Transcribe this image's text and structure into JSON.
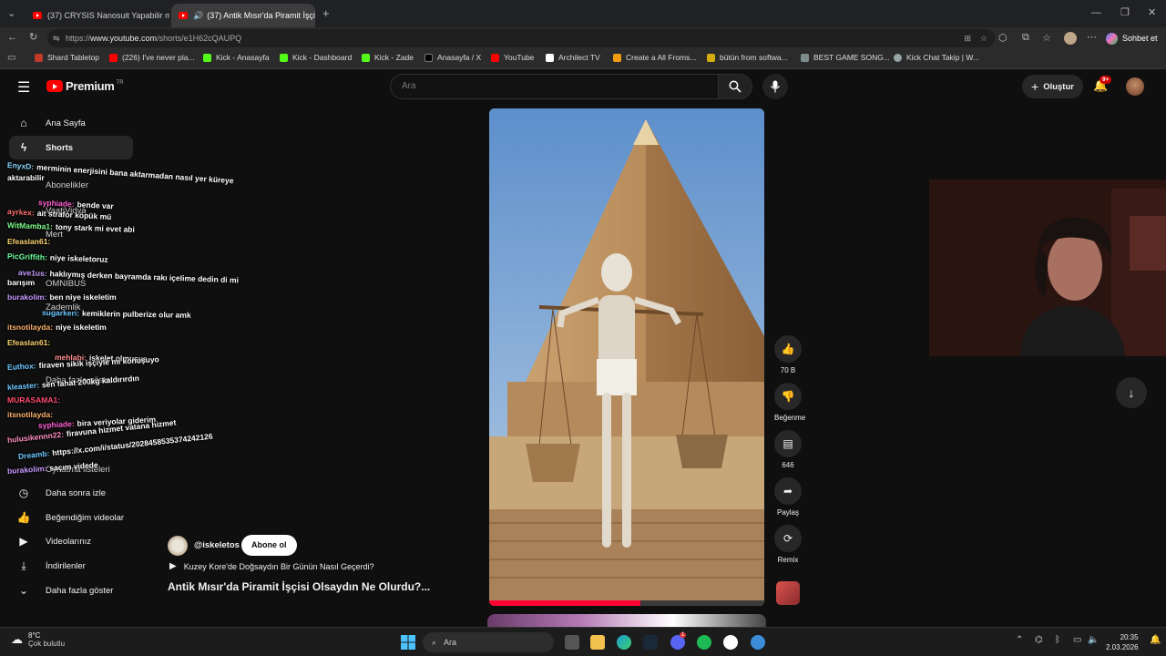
{
  "browser": {
    "tabs": [
      {
        "title": "(37) CRYSIS Nanosuit Yapabilir mi?"
      },
      {
        "title": "(37) Antik Mısır'da Piramit İşçi"
      }
    ],
    "new_tab": "+",
    "url_prefix": "https://",
    "url_host": "www.youtube.com",
    "url_path": "/shorts/e1H62cQAUPQ",
    "profile_button": "Sohbet et",
    "bookmarks": [
      {
        "label": "Shard Tabletop",
        "color": "#c0392b"
      },
      {
        "label": "(226) I've never pla...",
        "color": "#ff0000"
      },
      {
        "label": "Kick - Anasayfa",
        "color": "#53fc18"
      },
      {
        "label": "Kick - Dashboard",
        "color": "#53fc18"
      },
      {
        "label": "Kick - Zade",
        "color": "#53fc18"
      },
      {
        "label": "Anasayfa / X",
        "color": "#000000"
      },
      {
        "label": "YouTube",
        "color": "#ff0000"
      },
      {
        "label": "Archilect TV",
        "color": "#ffffff"
      },
      {
        "label": "Create a All Froms...",
        "color": "#f39c12"
      },
      {
        "label": "bütün from softwa...",
        "color": "#d4ac0d"
      },
      {
        "label": "BEST GAME SONG...",
        "color": "#7f8c8d"
      },
      {
        "label": "Kick Chat Takip | W...",
        "color": "#95a5a6"
      }
    ]
  },
  "youtube": {
    "logo": "Premium",
    "logo_sup": "TR",
    "search_placeholder": "Ara",
    "create_label": "Oluştur",
    "notif_badge": "9+",
    "sidebar": {
      "top": [
        {
          "label": "Ana Sayfa",
          "icon": "home-icon"
        },
        {
          "label": "Shorts",
          "icon": "shorts-icon"
        }
      ],
      "hidden": [
        "Abonelikler",
        "VaatiVidya",
        "Mert",
        "OMNIBUS",
        "Zademlik",
        "Daha fazla göster",
        "Oynatma listeleri"
      ],
      "bottom": [
        {
          "label": "Daha sonra izle",
          "icon": "clock-icon"
        },
        {
          "label": "Beğendiğim videolar",
          "icon": "thumb-up-icon"
        },
        {
          "label": "Videolarınız",
          "icon": "video-icon"
        },
        {
          "label": "İndirilenler",
          "icon": "download-icon"
        },
        {
          "label": "Daha fazla göster",
          "icon": "chevron-down-icon"
        }
      ]
    },
    "short": {
      "channel": "@iskeletos",
      "subscribe": "Abone ol",
      "playlist": "Kuzey Kore'de Doğsaydın Bir Günün Nasıl Geçerdi?",
      "title": "Antik Mısır'da Piramit İşçisi Olsaydın Ne Olurdu?...",
      "progress": 0.55
    },
    "actions": [
      {
        "label": "70 B",
        "icon": "thumb-up-icon"
      },
      {
        "label": "Beğenme",
        "icon": "thumb-down-icon"
      },
      {
        "label": "646",
        "icon": "comment-icon"
      },
      {
        "label": "Paylaş",
        "icon": "share-icon"
      },
      {
        "label": "Remix",
        "icon": "remix-icon"
      }
    ]
  },
  "chat": [
    {
      "user": "EnyxD:",
      "msg": "merminin enerjisini bana aktarmadan nasıl yer küreye",
      "color": "#8ad4ff"
    },
    {
      "user": "aktarabilir",
      "msg": "",
      "color": "#ffffff"
    },
    {
      "user": "syphiade:",
      "msg": "bende var",
      "color": "#ff5fd2"
    },
    {
      "user": "ayrkex:",
      "msg": "ait strafor köpük mü",
      "color": "#ff6e6e"
    },
    {
      "user": "WitMamba1:",
      "msg": "tony stark mi evet abi",
      "color": "#7cfc8c"
    },
    {
      "user": "Efeaslan61:",
      "msg": "",
      "color": "#ffd36e"
    },
    {
      "user": "PicGriffith:",
      "msg": "niye iskeletoruz",
      "color": "#6eff9f"
    },
    {
      "user": "ave1us:",
      "msg": "haklıymış derken bayramda rakı içelime dedin di mi",
      "color": "#c79bff"
    },
    {
      "user": "barışım",
      "msg": "",
      "color": "#ffffff"
    },
    {
      "user": "burakolim:",
      "msg": "ben niye iskeletim",
      "color": "#c79bff"
    },
    {
      "user": "sugarkeri:",
      "msg": "kemiklerin pulberize olur amk",
      "color": "#6ec7ff"
    },
    {
      "user": "itsnotilayda:",
      "msg": "niye iskeletim",
      "color": "#ffb36e"
    },
    {
      "user": "Efeaslan61:",
      "msg": "",
      "color": "#ffd36e"
    },
    {
      "user": "mehlabi:",
      "msg": "iskelet olmusus",
      "color": "#ff8f8f"
    },
    {
      "user": "Euthox:",
      "msg": "firaven sikik işçiyle mi konuşuyo",
      "color": "#6ec7ff"
    },
    {
      "user": "kleaster:",
      "msg": "sen fahat 200kg kaldırırdın",
      "color": "#6ec7ff"
    },
    {
      "user": "MURASAMA1:",
      "msg": "",
      "color": "#ff4b6b"
    },
    {
      "user": "itsnotilayda:",
      "msg": "",
      "color": "#ffb36e"
    },
    {
      "user": "syphiade:",
      "msg": "bira veriyolar giderim",
      "color": "#ff5fd2"
    },
    {
      "user": "hulusikennn22:",
      "msg": "firavuna hizmet vatana hizmet",
      "color": "#ff8fbf"
    },
    {
      "user": "Dreamb:",
      "msg": "https://x.com/i/status/2028458535374242126",
      "color": "#6ec7ff"
    },
    {
      "user": "burakolim:",
      "msg": "saçım videde",
      "color": "#c79bff"
    }
  ],
  "taskbar": {
    "temp": "8°C",
    "weather": "Çok bulutlu",
    "search": "Ara",
    "time": "20:35",
    "date": "2.03.2026",
    "notif": "1"
  }
}
